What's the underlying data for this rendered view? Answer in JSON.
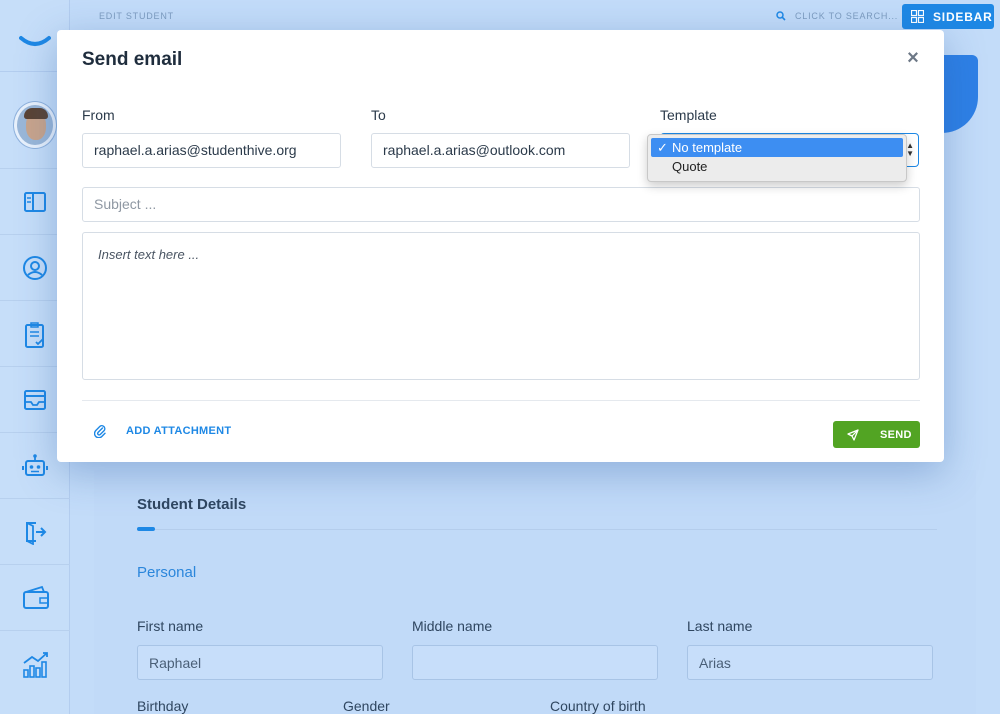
{
  "topbar": {
    "breadcrumb": "EDIT STUDENT",
    "search_label": "CLICK TO SEARCH...",
    "sidebar_button": "SIDEBAR"
  },
  "rail": {
    "icons": [
      "logo-icon",
      "avatar",
      "layout-icon",
      "user-icon",
      "clipboard-icon",
      "inbox-icon",
      "robot-icon",
      "exit-icon",
      "wallet-icon",
      "chart-icon"
    ]
  },
  "modal": {
    "title": "Send email",
    "close_glyph": "×",
    "from": {
      "label": "From",
      "value": "raphael.a.arias@studenthive.org"
    },
    "to": {
      "label": "To",
      "value": "raphael.a.arias@outlook.com"
    },
    "template": {
      "label": "Template",
      "options": [
        "No template",
        "Quote"
      ],
      "selected": "No template",
      "check_glyph": "✓"
    },
    "subject_placeholder": "Subject ...",
    "body_placeholder": "Insert text here ...",
    "add_attachment": "ADD ATTACHMENT",
    "send": "SEND"
  },
  "background": {
    "section_title": "Student Details",
    "subsection": "Personal",
    "fields": [
      {
        "label": "First name",
        "value": "Raphael"
      },
      {
        "label": "Middle name",
        "value": ""
      },
      {
        "label": "Last name",
        "value": "Arias"
      }
    ],
    "next_row_labels": [
      "Birthday",
      "Gender",
      "Country of birth"
    ]
  },
  "colors": {
    "accent": "#1e88e5",
    "send": "#52a423",
    "backdrop": "#c3dcf9"
  }
}
